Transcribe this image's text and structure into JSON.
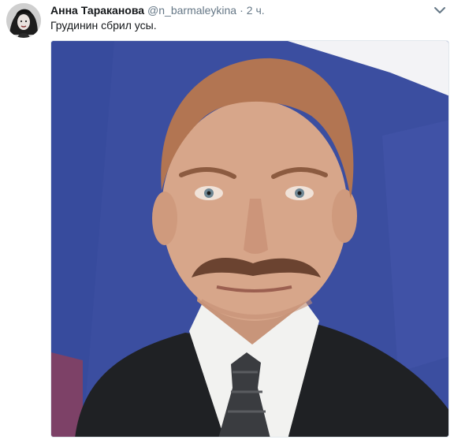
{
  "tweet": {
    "author_name": "Анна Тараканова",
    "author_handle": "@n_barmaleykina",
    "separator": "·",
    "time": "2 ч.",
    "text": "Грудинин сбрил усы.",
    "media": {
      "description_colors": {
        "flag_white": "#f3f3f6",
        "flag_blue": "#3b4ea0",
        "flag_red": "#c63a35",
        "suit": "#1f2124",
        "shirt": "#f2f2f0",
        "skin": "#d7a68a",
        "hair": "#b27552"
      }
    },
    "icons": {
      "avatar": "avatar-photo",
      "caret": "chevron-down-icon"
    }
  }
}
